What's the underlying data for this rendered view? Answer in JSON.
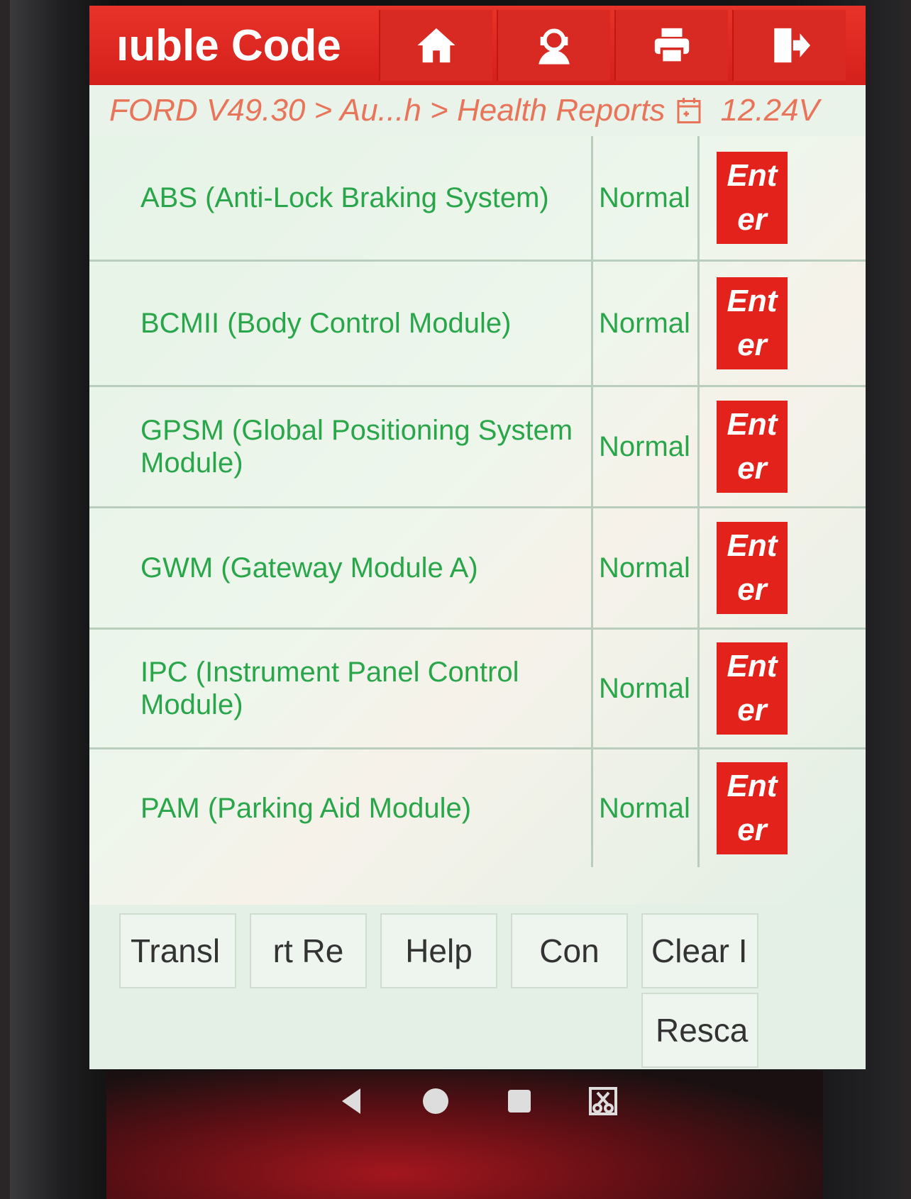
{
  "header": {
    "title": "ıuble Code",
    "buttons": [
      {
        "name": "home-icon"
      },
      {
        "name": "support-agent-icon"
      },
      {
        "name": "printer-icon"
      },
      {
        "name": "exit-icon"
      }
    ]
  },
  "breadcrumb": {
    "path": "FORD V49.30 > Au...h > Health Reports",
    "voltage": "12.24V"
  },
  "modules": [
    {
      "name": "ABS (Anti-Lock Braking System)",
      "status": "Normal",
      "enter_1": "Ent",
      "enter_2": "er"
    },
    {
      "name": "BCMII (Body Control Module)",
      "status": "Normal",
      "enter_1": "Ent",
      "enter_2": "er"
    },
    {
      "name": "GPSM (Global Positioning System Module)",
      "status": "Normal",
      "enter_1": "Ent",
      "enter_2": "er"
    },
    {
      "name": "GWM (Gateway Module A)",
      "status": "Normal",
      "enter_1": "Ent",
      "enter_2": "er"
    },
    {
      "name": "IPC (Instrument Panel Control Module)",
      "status": "Normal",
      "enter_1": "Ent",
      "enter_2": "er"
    },
    {
      "name": "PAM (Parking Aid Module)",
      "status": "Normal",
      "enter_1": "Ent",
      "enter_2": "er"
    }
  ],
  "toolbar": {
    "translate": "Transl",
    "report": "rt Re",
    "help": "Help",
    "con": "Con",
    "clear": "Clear I",
    "rescan": "Resca"
  },
  "colors": {
    "header_red": "#d4201a",
    "text_green": "#2aa64a",
    "crumb_orange": "#e8745a"
  }
}
